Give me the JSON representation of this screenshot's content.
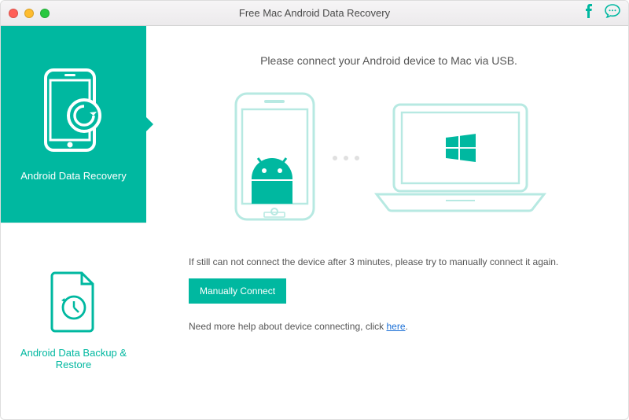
{
  "window": {
    "title": "Free Mac Android Data Recovery"
  },
  "sidebar": {
    "items": [
      {
        "label": "Android Data Recovery"
      },
      {
        "label": "Android Data Backup & Restore"
      }
    ]
  },
  "main": {
    "heading": "Please connect your Android device to Mac via USB.",
    "help_text": "If still can not connect the device after 3 minutes, please try to manually connect it again.",
    "connect_button": "Manually Connect",
    "more_help_prefix": "Need more help about device connecting, click ",
    "more_help_link": "here",
    "more_help_suffix": "."
  }
}
